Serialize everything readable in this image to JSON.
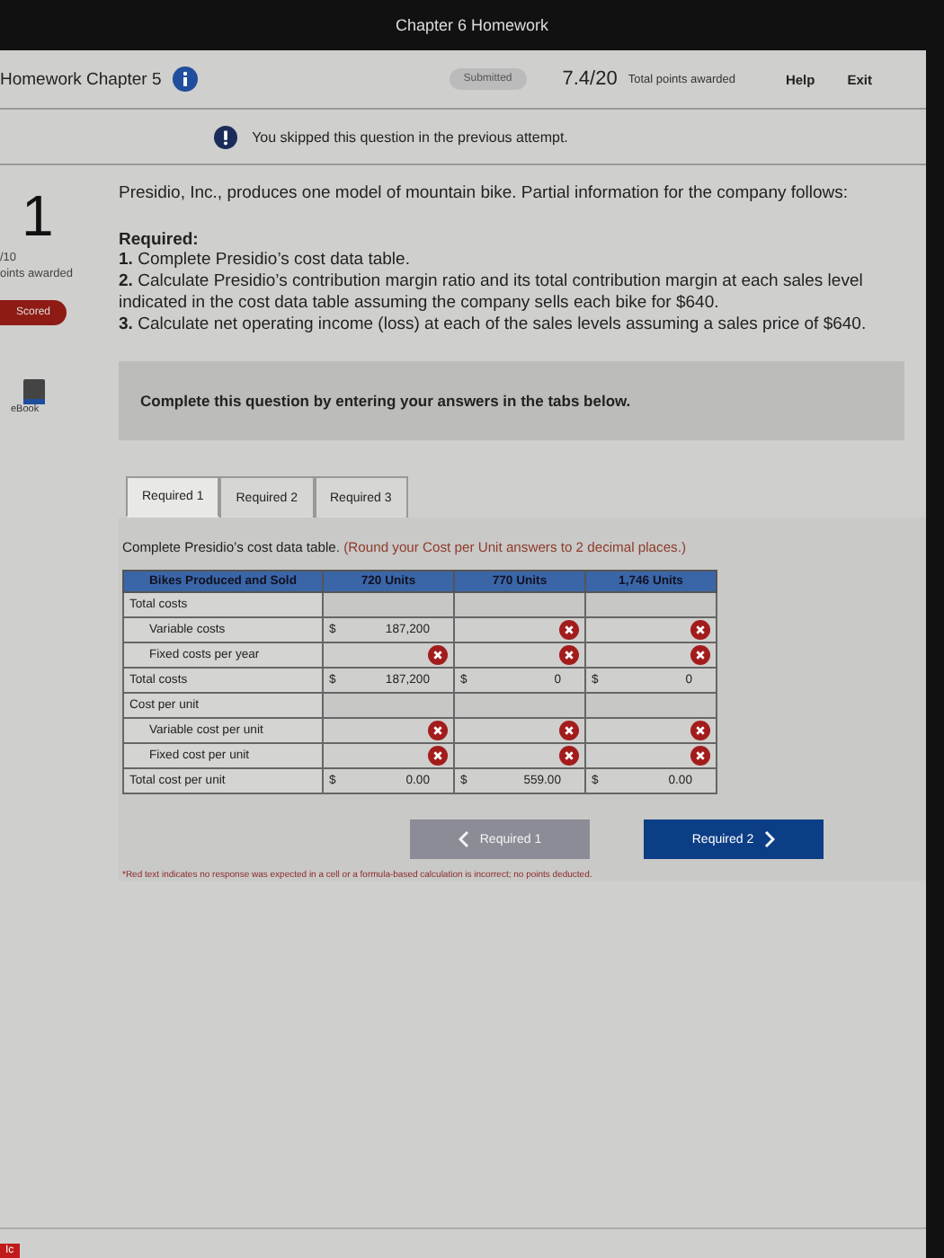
{
  "window": {
    "title": "Chapter 6 Homework"
  },
  "header": {
    "assignment": "Homework Chapter 5",
    "status": "Submitted",
    "score": "7.4/20",
    "score_label": "Total points awarded",
    "links": [
      "Help",
      "Exit"
    ]
  },
  "alert": "You skipped this question in the previous attempt.",
  "sidebar": {
    "number": "1",
    "points": "/10",
    "points_label": "oints awarded",
    "badge": "Scored",
    "ebook": "eBook"
  },
  "question": {
    "intro": "Presidio, Inc., produces one model of mountain bike. Partial information for the company follows:",
    "required_title": "Required:",
    "items": [
      {
        "num": "1.",
        "text": "Complete Presidio’s cost data table."
      },
      {
        "num": "2.",
        "text": "Calculate Presidio’s contribution margin ratio and its total contribution margin at each sales level indicated in the cost data table assuming the company sells each bike for $640."
      },
      {
        "num": "3.",
        "text": "Calculate net operating income (loss) at each of the sales levels assuming a sales price of $640."
      }
    ]
  },
  "panel_title": "Complete this question by entering your answers in the tabs below.",
  "tabs": [
    {
      "label": "Required 1",
      "selected": true
    },
    {
      "label": "Required 2",
      "selected": false
    },
    {
      "label": "Required 3",
      "selected": false
    }
  ],
  "instruction": "Complete Presidio’s cost data table.",
  "instruction_note": "(Round your Cost per Unit answers to 2 decimal places.)",
  "table": {
    "columns": [
      "Bikes Produced and Sold",
      "720 Units",
      "770 Units",
      "1,746 Units"
    ],
    "rows": [
      {
        "kind": "section",
        "cells": [
          {
            "value": "Total costs"
          },
          {},
          {},
          {}
        ]
      },
      {
        "kind": "item",
        "cells": [
          {
            "value": "Variable costs"
          },
          {
            "prefix": "$",
            "value": "187,200",
            "wrong": false
          },
          {
            "wrong": true
          },
          {
            "wrong": true
          }
        ]
      },
      {
        "kind": "item",
        "cells": [
          {
            "value": "Fixed costs per year"
          },
          {
            "wrong": true
          },
          {
            "wrong": true
          },
          {
            "wrong": true
          }
        ]
      },
      {
        "kind": "total",
        "cells": [
          {
            "value": "Total costs"
          },
          {
            "prefix": "$",
            "value": "187,200",
            "wrong": false
          },
          {
            "prefix": "$",
            "value": "0",
            "wrong": false
          },
          {
            "prefix": "$",
            "value": "0",
            "wrong": false
          }
        ]
      },
      {
        "kind": "section",
        "cells": [
          {
            "value": "Cost per unit"
          },
          {},
          {},
          {}
        ]
      },
      {
        "kind": "item",
        "cells": [
          {
            "value": "Variable cost per unit"
          },
          {
            "wrong": true
          },
          {
            "wrong": true
          },
          {
            "wrong": true
          }
        ]
      },
      {
        "kind": "item",
        "cells": [
          {
            "value": "Fixed cost per unit"
          },
          {
            "wrong": true
          },
          {
            "wrong": true
          },
          {
            "wrong": true
          }
        ]
      },
      {
        "kind": "total",
        "cells": [
          {
            "value": "Total cost per unit"
          },
          {
            "prefix": "$",
            "value": "0.00",
            "wrong": false
          },
          {
            "prefix": "$",
            "value": "559.00",
            "wrong": false
          },
          {
            "prefix": "$",
            "value": "0.00",
            "wrong": false
          }
        ]
      }
    ]
  },
  "nav": [
    {
      "label": "Required 1",
      "kind": "prev",
      "disabled": true
    },
    {
      "label": "Required 2",
      "kind": "next",
      "disabled": false
    }
  ],
  "footnote": "*Red text indicates no response was expected in a cell or a formula-based calculation is incorrect; no points deducted.",
  "corner_tab": "Ic"
}
